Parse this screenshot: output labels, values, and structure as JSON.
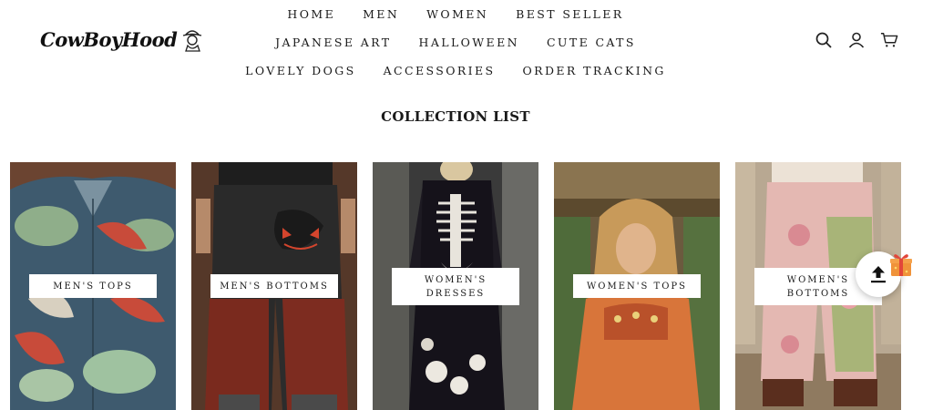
{
  "brand": {
    "logo_text": "CowBoyHood"
  },
  "nav": {
    "row1": [
      "HOME",
      "MEN",
      "WOMEN",
      "BEST SELLER"
    ],
    "row2": [
      "JAPANESE ART",
      "HALLOWEEN",
      "CUTE CATS"
    ],
    "row3": [
      "LOVELY DOGS",
      "ACCESSORIES",
      "ORDER TRACKING"
    ]
  },
  "header_icons": [
    "search-icon",
    "account-icon",
    "cart-icon"
  ],
  "section": {
    "title": "COLLECTION LIST"
  },
  "collections": [
    {
      "line1": "MEN'S TOPS",
      "line2": ""
    },
    {
      "line1": "MEN'S BOTTOMS",
      "line2": ""
    },
    {
      "line1": "WOMEN'S",
      "line2": "DRESSES"
    },
    {
      "line1": "WOMEN'S TOPS",
      "line2": ""
    },
    {
      "line1": "WOMEN'S",
      "line2": "BOTTOMS"
    }
  ],
  "floating": {
    "icons": [
      "upload-icon",
      "gift-icon"
    ]
  }
}
